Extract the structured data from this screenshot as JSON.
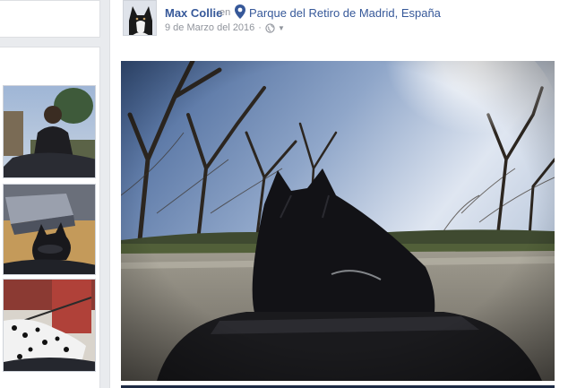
{
  "post": {
    "author": "Max Collie",
    "in_word": "en",
    "location": "Parque del Retiro de Madrid, España",
    "date": "9 de Marzo del 2016",
    "separator": "·",
    "privacy_icon": "globe-icon",
    "audience_caret": "▼"
  },
  "sidebar": {
    "thumbnails": [
      {
        "icon": "photo-person-with-dog-thumbnail"
      },
      {
        "icon": "photo-dog-on-chair-thumbnail"
      },
      {
        "icon": "photo-dalmatian-thumbnail"
      }
    ]
  },
  "colors": {
    "page_bg": "#e9ebee",
    "link_blue": "#365899",
    "meta_gray": "#90949c"
  }
}
